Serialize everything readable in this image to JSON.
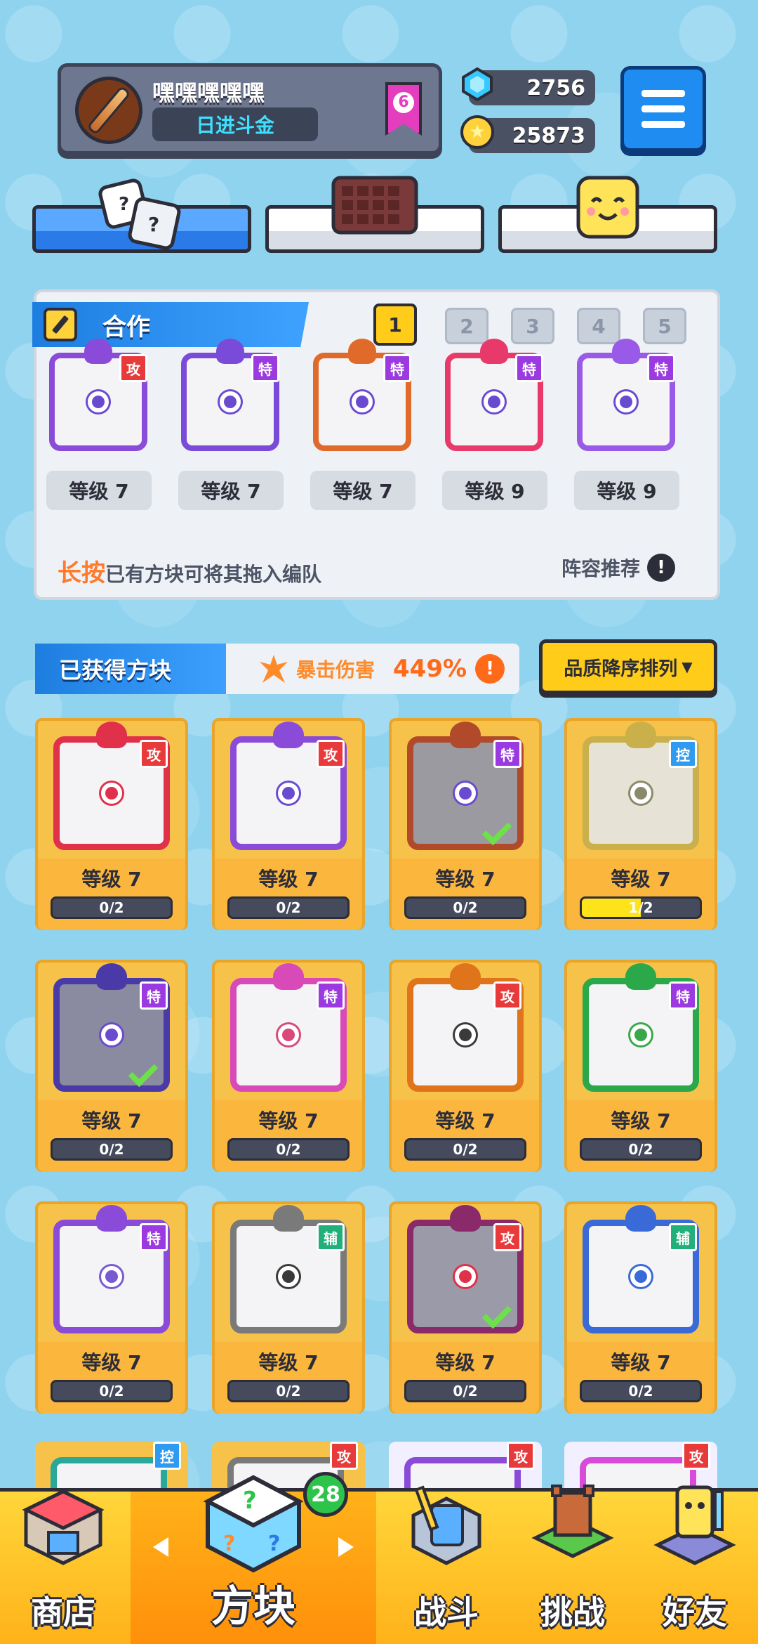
{
  "player": {
    "name": "嘿嘿嘿嘿嘿",
    "title": "日进斗金",
    "rank": "6"
  },
  "currency": {
    "gems": "2756",
    "coins": "25873"
  },
  "team": {
    "section_label": "合作",
    "pages": [
      "1",
      "2",
      "3",
      "4",
      "5"
    ],
    "active_page": "1",
    "members": [
      {
        "tag": "攻",
        "level": "等级 7",
        "color": "#8a4bd8"
      },
      {
        "tag": "特",
        "level": "等级 7",
        "color": "#7a4bd8"
      },
      {
        "tag": "特",
        "level": "等级 7",
        "color": "#e06a2a"
      },
      {
        "tag": "特",
        "level": "等级 9",
        "color": "#e83a6a"
      },
      {
        "tag": "特",
        "level": "等级 9",
        "color": "#9a5ae8"
      }
    ],
    "hint_em": "长按",
    "hint_rest": "已有方块可将其拖入编队",
    "recommend_label": "阵容推荐"
  },
  "owned": {
    "title": "已获得方块",
    "crit_label": "暴击伤害",
    "crit_value": "449%",
    "sort_label": "品质降序排列"
  },
  "cards": [
    {
      "tag": "攻",
      "tag_type": "atk",
      "level": "等级 7",
      "progress": "0/2",
      "progress_frac": 0,
      "color": "#e0304a",
      "dot": "#e0304a",
      "bg": "#f4f4f6",
      "equipped": false
    },
    {
      "tag": "攻",
      "tag_type": "atk",
      "level": "等级 7",
      "progress": "0/2",
      "progress_frac": 0,
      "color": "#8a4bd8",
      "dot": "#6a4bd0",
      "bg": "#f4f4f6",
      "equipped": false
    },
    {
      "tag": "特",
      "tag_type": "spe",
      "level": "等级 7",
      "progress": "0/2",
      "progress_frac": 0,
      "color": "#b04a2a",
      "dot": "#6a4bd0",
      "bg": "#9a9aa0",
      "equipped": true
    },
    {
      "tag": "控",
      "tag_type": "ctl",
      "level": "等级 7",
      "progress": "1/2",
      "progress_frac": 0.5,
      "color": "#c9b04a",
      "dot": "#8a8a6a",
      "bg": "#e6e2d6",
      "equipped": false
    },
    {
      "tag": "特",
      "tag_type": "spe",
      "level": "等级 7",
      "progress": "0/2",
      "progress_frac": 0,
      "color": "#4a3aa8",
      "dot": "#6a4bd0",
      "bg": "#8a8aa0",
      "equipped": true
    },
    {
      "tag": "特",
      "tag_type": "spe",
      "level": "等级 7",
      "progress": "0/2",
      "progress_frac": 0,
      "color": "#d84ab8",
      "dot": "#d84a7a",
      "bg": "#f4f4f6",
      "equipped": false
    },
    {
      "tag": "攻",
      "tag_type": "atk",
      "level": "等级 7",
      "progress": "0/2",
      "progress_frac": 0,
      "color": "#e0741a",
      "dot": "#3a3a3a",
      "bg": "#f4f4f6",
      "equipped": false
    },
    {
      "tag": "特",
      "tag_type": "spe",
      "level": "等级 7",
      "progress": "0/2",
      "progress_frac": 0,
      "color": "#2aa84a",
      "dot": "#3aa84a",
      "bg": "#f4f4f6",
      "equipped": false
    },
    {
      "tag": "特",
      "tag_type": "spe",
      "level": "等级 7",
      "progress": "0/2",
      "progress_frac": 0,
      "color": "#8a4bd8",
      "dot": "#7a5ad0",
      "bg": "#f4f4f6",
      "equipped": false
    },
    {
      "tag": "辅",
      "tag_type": "sup",
      "level": "等级 7",
      "progress": "0/2",
      "progress_frac": 0,
      "color": "#7a7a7a",
      "dot": "#3a3a3a",
      "bg": "#f4f4f6",
      "equipped": false
    },
    {
      "tag": "攻",
      "tag_type": "atk",
      "level": "等级 7",
      "progress": "0/2",
      "progress_frac": 0,
      "color": "#8a2a6a",
      "dot": "#e0304a",
      "bg": "#9a9aa8",
      "equipped": true
    },
    {
      "tag": "辅",
      "tag_type": "sup",
      "level": "等级 7",
      "progress": "0/2",
      "progress_frac": 0,
      "color": "#3a6ad8",
      "dot": "#3a6ad8",
      "bg": "#f4f4f6",
      "equipped": false
    }
  ],
  "partial_cards": [
    {
      "tag": "控",
      "tag_type": "ctl",
      "color": "#2aa89a"
    },
    {
      "tag": "攻",
      "tag_type": "atk",
      "color": "#7a7a7a"
    },
    {
      "tag": "攻",
      "tag_type": "atk",
      "color": "#8a4bd8"
    },
    {
      "tag": "攻",
      "tag_type": "atk",
      "color": "#d84ad8"
    }
  ],
  "nav": {
    "items": [
      "商店",
      "方块",
      "战斗",
      "挑战",
      "好友"
    ],
    "active": "方块",
    "badge": "28"
  },
  "colors": {
    "background": "#8fd3ef",
    "accent_blue": "#1e8cf0",
    "accent_yellow": "#ffcc1a",
    "card": "#f7c24a"
  },
  "icons": {
    "gem": "gem-icon",
    "coin": "coin-icon",
    "menu": "menu-icon",
    "pencil": "pencil-icon",
    "exclamation": "exclamation-icon",
    "crit": "crit-icon",
    "check": "check-icon"
  }
}
